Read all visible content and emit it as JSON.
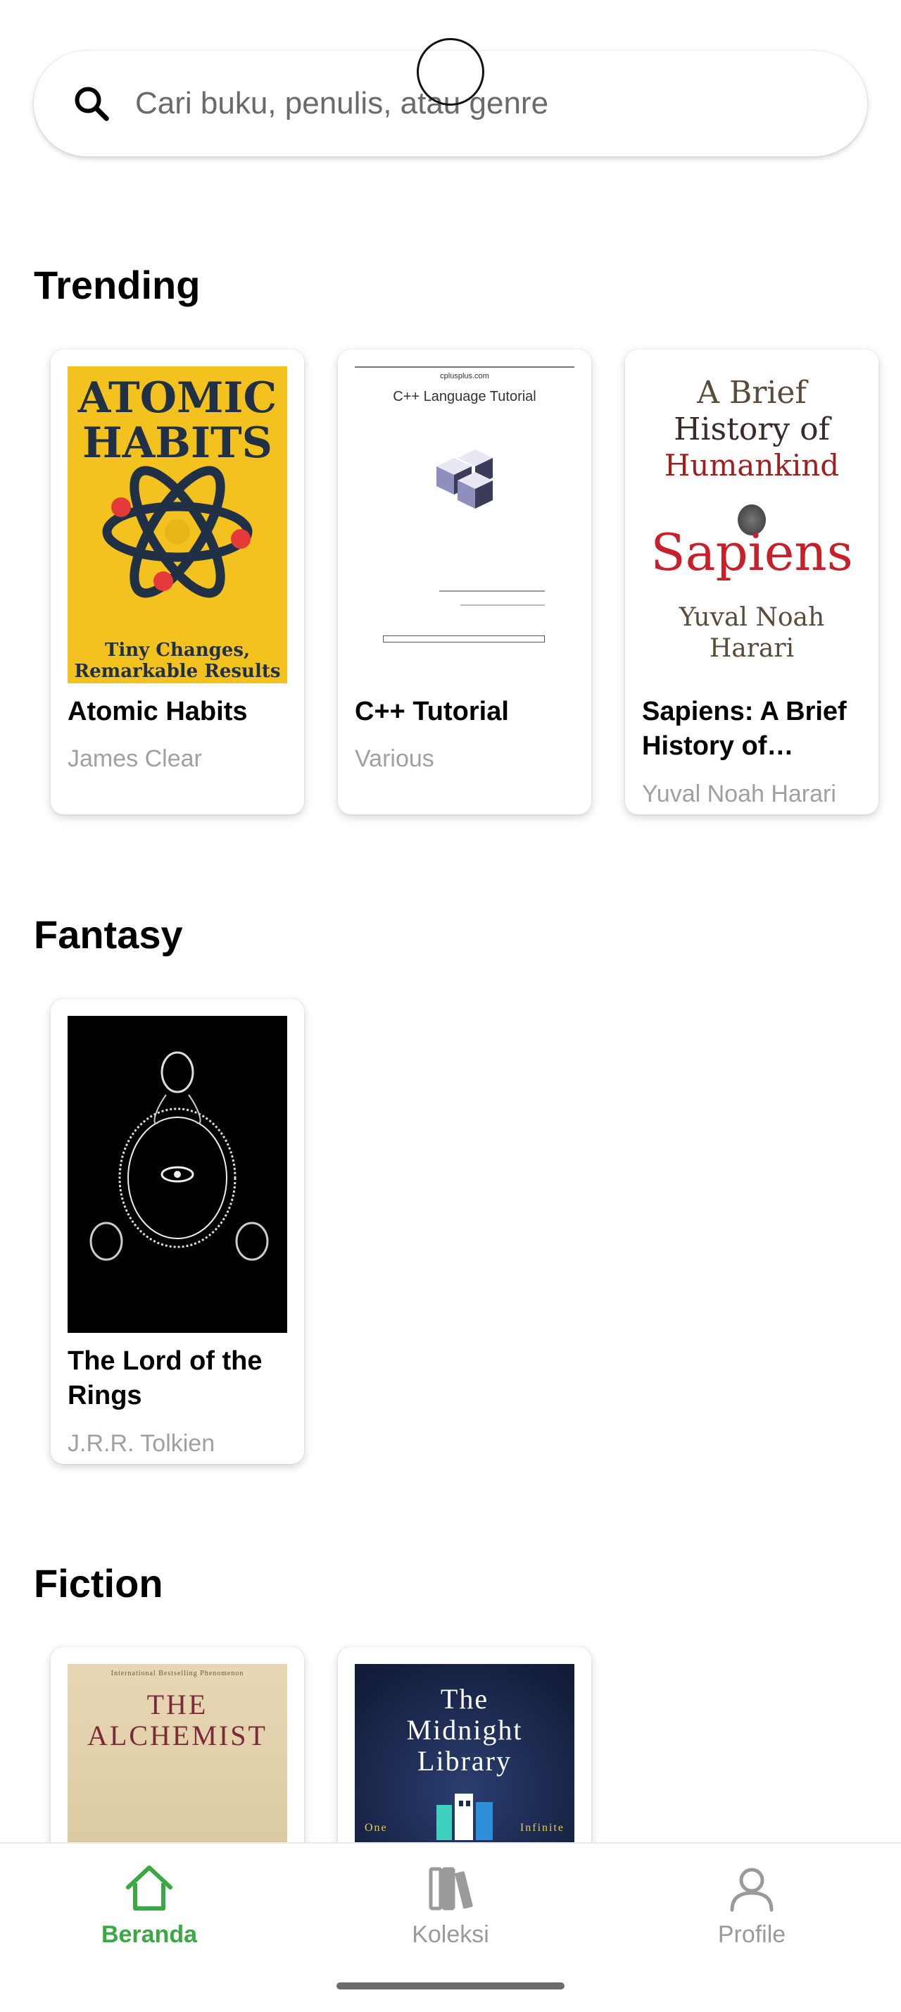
{
  "search": {
    "placeholder": "Cari buku, penulis, atau genre",
    "icon": "search-icon"
  },
  "sections": [
    {
      "title": "Trending",
      "books": [
        {
          "title": "Atomic Habits",
          "author": "James Clear",
          "cover_text": [
            "ATOMIC",
            "HABITS",
            "Tiny Changes,",
            "Remarkable Results"
          ]
        },
        {
          "title": "C++ Tutorial",
          "author": "Various",
          "cover_text": [
            "cplusplus.com",
            "C++ Language Tutorial"
          ]
        },
        {
          "title": "Sapiens: A Brief History of Humankind",
          "author": "Yuval Noah Harari",
          "cover_text": [
            "A Brief",
            "History of",
            "Humankind",
            "Sapiens",
            "Yuval Noah",
            "Harari"
          ]
        }
      ]
    },
    {
      "title": "Fantasy",
      "books": [
        {
          "title": "The Lord of the Rings",
          "author": "J.R.R. Tolkien"
        }
      ]
    },
    {
      "title": "Fiction",
      "books": [
        {
          "title": "The Alchemist",
          "author": "",
          "cover_text": [
            "International Bestselling Phenomenon",
            "THE",
            "ALCHEMIST"
          ]
        },
        {
          "title": "The Midnight Library",
          "author": "",
          "cover_text": [
            "The",
            "Midnight",
            "Library",
            "One",
            "Infinite"
          ]
        }
      ]
    }
  ],
  "nav": [
    {
      "label": "Beranda",
      "icon": "home-icon",
      "active": true
    },
    {
      "label": "Koleksi",
      "icon": "books-icon",
      "active": false
    },
    {
      "label": "Profile",
      "icon": "person-icon",
      "active": false
    }
  ],
  "colors": {
    "accent": "#3aa843",
    "inactive": "#9a9a9a"
  }
}
